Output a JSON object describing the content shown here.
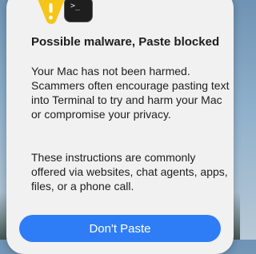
{
  "dialog": {
    "title": "Possible malware, Paste blocked",
    "body_paragraph_1": "Your Mac has not been harmed. Scammers often encourage pasting text into Terminal to try and harm your Mac or compromise your privacy.",
    "body_paragraph_2": "These instructions are commonly offered via websites, chat agents, apps, files, or a phone call.",
    "primary_button_label": "Don't Paste",
    "terminal_prompt": ">_"
  },
  "icons": {
    "warning": "warning-icon",
    "terminal": "terminal-icon"
  },
  "colors": {
    "accent": "#2f7df6",
    "warning": "#f5c518",
    "dialog_background": "#f1f1f1",
    "text": "#1d1d1f"
  }
}
